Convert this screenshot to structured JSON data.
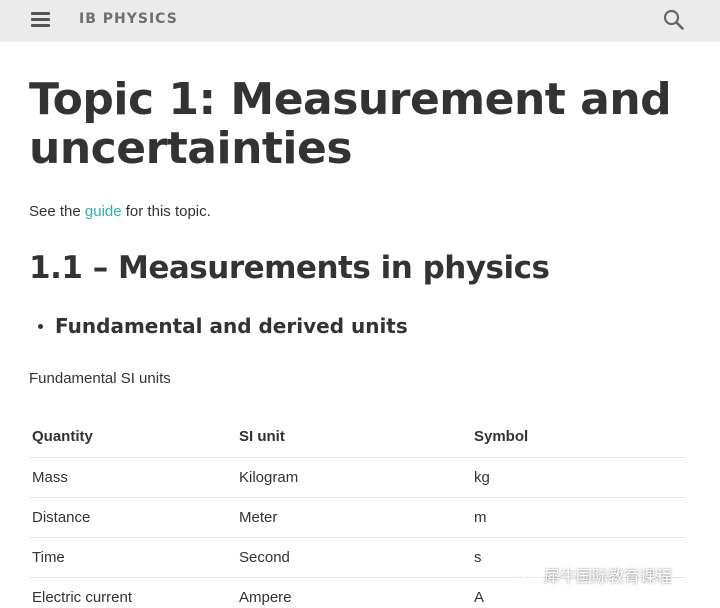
{
  "header": {
    "site_title": "IB PHYSICS",
    "menu_icon": "hamburger-menu-icon",
    "search_icon": "search-icon"
  },
  "page": {
    "title": "Topic 1: Measurement and uncertainties",
    "intro_before": "See the ",
    "intro_link": "guide",
    "intro_after": " for this topic.",
    "section_title": "1.1 – Measurements in physics",
    "subsection_title": "Fundamental and derived units",
    "table_caption": "Fundamental SI units"
  },
  "table": {
    "headers": [
      "Quantity",
      "SI unit",
      "Symbol"
    ],
    "rows": [
      [
        "Mass",
        "Kilogram",
        "kg"
      ],
      [
        "Distance",
        "Meter",
        "m"
      ],
      [
        "Time",
        "Second",
        "s"
      ],
      [
        "Electric current",
        "Ampere",
        "A"
      ]
    ]
  },
  "watermark": {
    "text": "犀牛国际教育课程"
  },
  "colors": {
    "header_bg": "#ebebeb",
    "link": "#2bb3a6",
    "text": "#333333"
  }
}
